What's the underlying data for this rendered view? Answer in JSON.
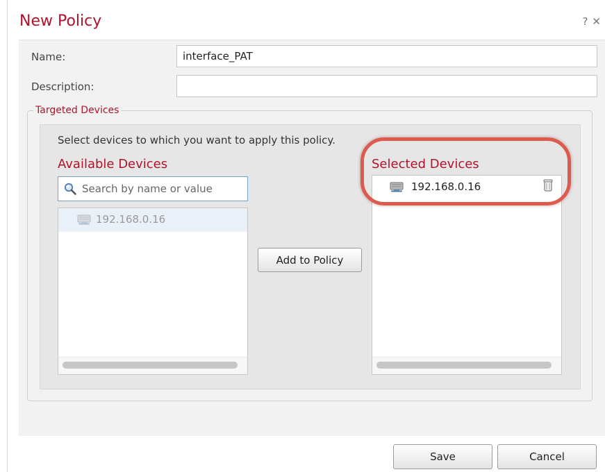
{
  "dialog": {
    "title": "New Policy",
    "help_icon": "?",
    "close_icon": "✕"
  },
  "form": {
    "name_label": "Name:",
    "name_value": "interface_PAT",
    "description_label": "Description:",
    "description_value": ""
  },
  "targeted_devices": {
    "legend": "Targeted Devices",
    "instructions": "Select devices to which you want to apply this policy.",
    "available": {
      "heading": "Available Devices",
      "search_placeholder": "Search by name or value",
      "items": [
        {
          "label": "192.168.0.16",
          "icon": "device-icon",
          "state": "already-added"
        }
      ]
    },
    "add_button": "Add to Policy",
    "selected": {
      "heading": "Selected Devices",
      "items": [
        {
          "label": "192.168.0.16",
          "icon": "device-icon",
          "action_icon": "trash-icon"
        }
      ]
    }
  },
  "footer": {
    "save_label": "Save",
    "cancel_label": "Cancel"
  },
  "colors": {
    "accent": "#b0132b",
    "highlight_ring": "#dd5a4f",
    "panel_bg": "#f2f2f2",
    "selected_row": "#e9f0f8"
  }
}
